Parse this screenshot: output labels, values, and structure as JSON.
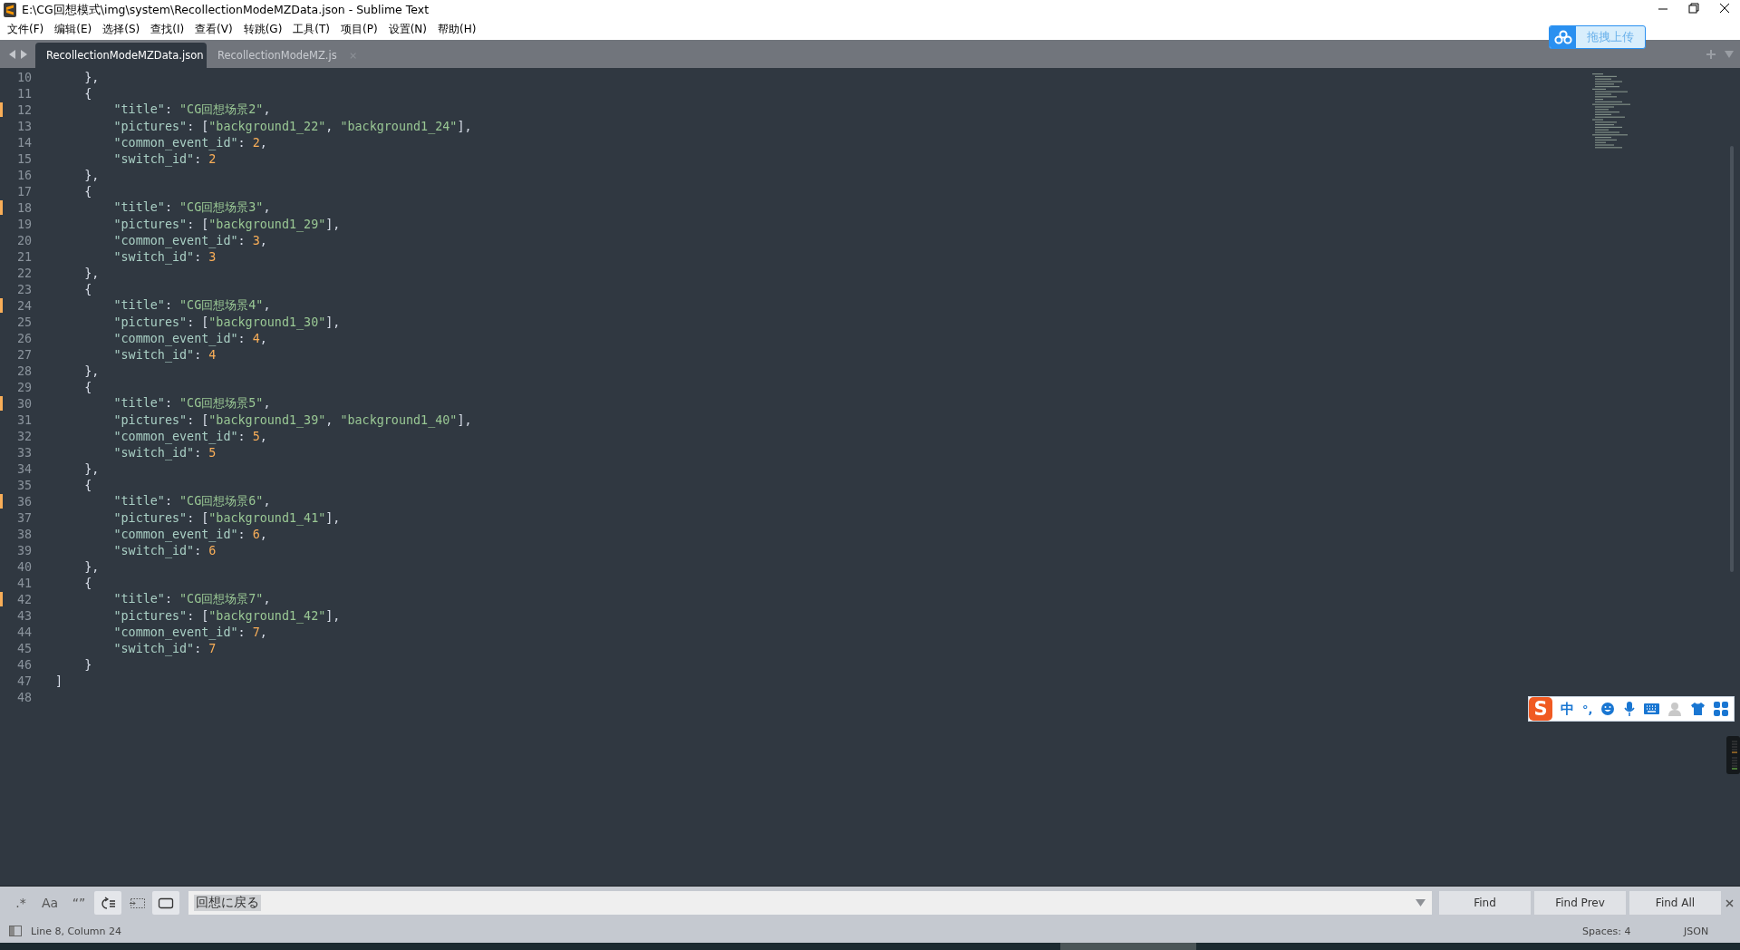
{
  "window": {
    "title": "E:\\CG回想模式\\img\\system\\RecollectionModeMZData.json - Sublime Text"
  },
  "menu": [
    "文件(F)",
    "编辑(E)",
    "选择(S)",
    "查找(I)",
    "查看(V)",
    "转跳(G)",
    "工具(T)",
    "项目(P)",
    "设置(N)",
    "帮助(H)"
  ],
  "tabs": [
    {
      "label": "RecollectionModeMZData.json",
      "selected": true
    },
    {
      "label": "RecollectionModeMZ.js",
      "selected": false
    }
  ],
  "editor": {
    "lines": [
      {
        "number": "10",
        "text": "    },",
        "modified": false
      },
      {
        "number": "11",
        "text": "    {",
        "modified": false
      },
      {
        "number": "12",
        "text": "        \"title\": \"CG回想场景2\",",
        "modified": true
      },
      {
        "number": "13",
        "text": "        \"pictures\": [\"background1_22\", \"background1_24\"],",
        "modified": false
      },
      {
        "number": "14",
        "text": "        \"common_event_id\": 2,",
        "modified": false
      },
      {
        "number": "15",
        "text": "        \"switch_id\": 2",
        "modified": false
      },
      {
        "number": "16",
        "text": "    },",
        "modified": false
      },
      {
        "number": "17",
        "text": "    {",
        "modified": false
      },
      {
        "number": "18",
        "text": "        \"title\": \"CG回想场景3\",",
        "modified": true
      },
      {
        "number": "19",
        "text": "        \"pictures\": [\"background1_29\"],",
        "modified": false
      },
      {
        "number": "20",
        "text": "        \"common_event_id\": 3,",
        "modified": false
      },
      {
        "number": "21",
        "text": "        \"switch_id\": 3",
        "modified": false
      },
      {
        "number": "22",
        "text": "    },",
        "modified": false
      },
      {
        "number": "23",
        "text": "    {",
        "modified": false
      },
      {
        "number": "24",
        "text": "        \"title\": \"CG回想场景4\",",
        "modified": true
      },
      {
        "number": "25",
        "text": "        \"pictures\": [\"background1_30\"],",
        "modified": false
      },
      {
        "number": "26",
        "text": "        \"common_event_id\": 4,",
        "modified": false
      },
      {
        "number": "27",
        "text": "        \"switch_id\": 4",
        "modified": false
      },
      {
        "number": "28",
        "text": "    },",
        "modified": false
      },
      {
        "number": "29",
        "text": "    {",
        "modified": false
      },
      {
        "number": "30",
        "text": "        \"title\": \"CG回想场景5\",",
        "modified": true
      },
      {
        "number": "31",
        "text": "        \"pictures\": [\"background1_39\", \"background1_40\"],",
        "modified": false
      },
      {
        "number": "32",
        "text": "        \"common_event_id\": 5,",
        "modified": false
      },
      {
        "number": "33",
        "text": "        \"switch_id\": 5",
        "modified": false
      },
      {
        "number": "34",
        "text": "    },",
        "modified": false
      },
      {
        "number": "35",
        "text": "    {",
        "modified": false
      },
      {
        "number": "36",
        "text": "        \"title\": \"CG回想场景6\",",
        "modified": true
      },
      {
        "number": "37",
        "text": "        \"pictures\": [\"background1_41\"],",
        "modified": false
      },
      {
        "number": "38",
        "text": "        \"common_event_id\": 6,",
        "modified": false
      },
      {
        "number": "39",
        "text": "        \"switch_id\": 6",
        "modified": false
      },
      {
        "number": "40",
        "text": "    },",
        "modified": false
      },
      {
        "number": "41",
        "text": "    {",
        "modified": false
      },
      {
        "number": "42",
        "text": "        \"title\": \"CG回想场景7\",",
        "modified": true
      },
      {
        "number": "43",
        "text": "        \"pictures\": [\"background1_42\"],",
        "modified": false
      },
      {
        "number": "44",
        "text": "        \"common_event_id\": 7,",
        "modified": false
      },
      {
        "number": "45",
        "text": "        \"switch_id\": 7",
        "modified": false
      },
      {
        "number": "46",
        "text": "    }",
        "modified": false
      },
      {
        "number": "47",
        "text": "]",
        "modified": false
      },
      {
        "number": "48",
        "modified": false
      }
    ]
  },
  "find_panel": {
    "toggles": [
      {
        "kind": "regex",
        "label": ".*",
        "selected": false
      },
      {
        "kind": "case",
        "label": "Aa",
        "selected": false
      },
      {
        "kind": "word",
        "label": "“”",
        "selected": false
      },
      {
        "kind": "wrap",
        "selected": true
      },
      {
        "kind": "in_selection",
        "selected": false
      },
      {
        "kind": "highlight",
        "selected": true
      }
    ],
    "query": "回想に戻る",
    "buttons": [
      "Find",
      "Find Prev",
      "Find All"
    ]
  },
  "status_bar": {
    "position": "Line 8, Column 24",
    "indentation": "Spaces: 4",
    "syntax": "JSON"
  },
  "upload_widget": {
    "label": "拖拽上传"
  },
  "ime_bar": {
    "logo": "S",
    "mode": "中",
    "punctuation": "°,"
  }
}
